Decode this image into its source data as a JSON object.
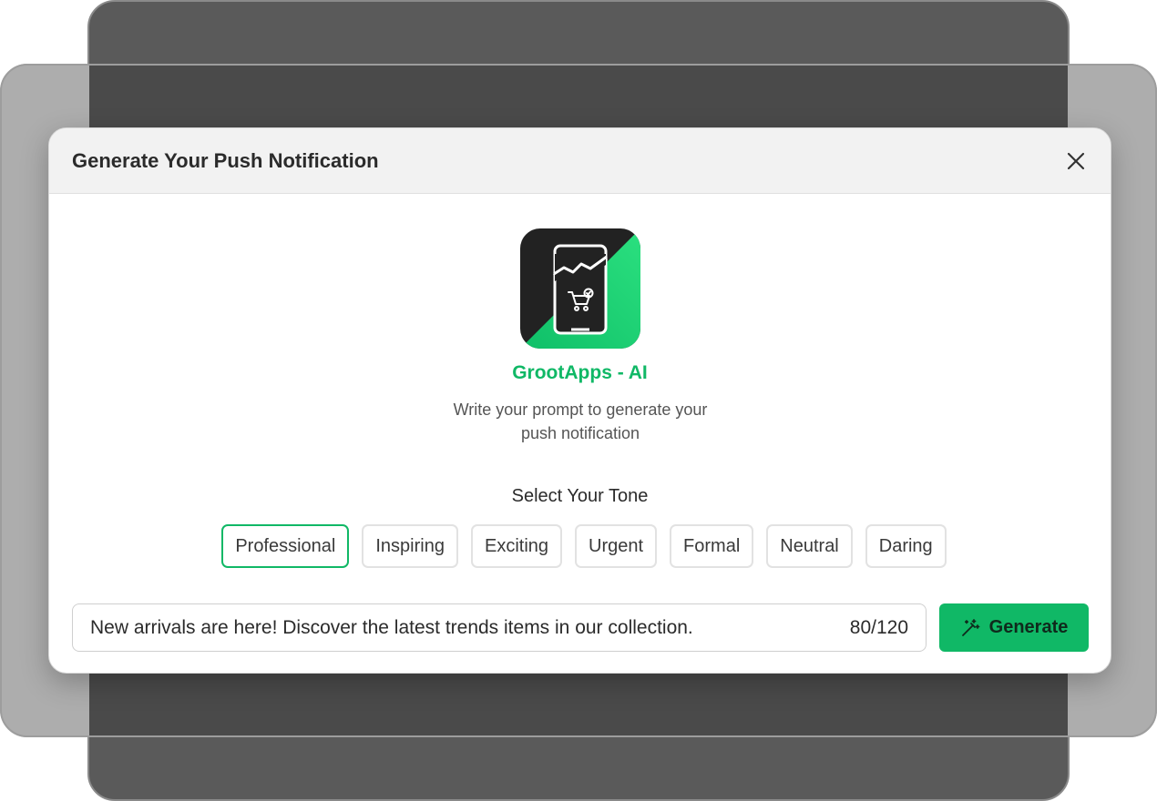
{
  "modal": {
    "title": "Generate Your Push Notification",
    "close_icon": "close-icon"
  },
  "app": {
    "name": "GrootApps - AI",
    "logo_icon": "phone-chart-cart-icon",
    "subtitle_line1": "Write your prompt to generate your",
    "subtitle_line2": "push notification"
  },
  "tone": {
    "label": "Select Your Tone",
    "options": [
      "Professional",
      "Inspiring",
      "Exciting",
      "Urgent",
      "Formal",
      "Neutral",
      "Daring"
    ],
    "selected": "Professional"
  },
  "prompt": {
    "value": "New arrivals are here! Discover the latest trends items in our collection.",
    "count": "80/120"
  },
  "generate": {
    "label": "Generate",
    "icon": "magic-wand-icon"
  },
  "colors": {
    "accent": "#10b866",
    "logo_dark": "#222222",
    "logo_green": "#1fd673"
  }
}
